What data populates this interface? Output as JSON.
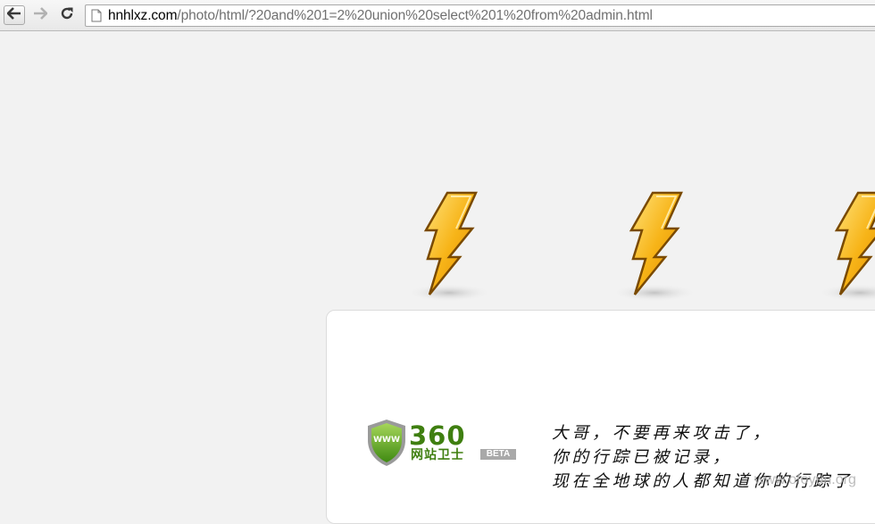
{
  "browser": {
    "url_host": "hnhlxz.com",
    "url_path": "/photo/html/?20and%201=2%20union%20select%201%20from%20admin.html",
    "back_icon": "back-arrow-icon",
    "forward_icon": "forward-arrow-icon",
    "reload_icon": "reload-icon",
    "page_icon": "page-icon"
  },
  "page": {
    "bolts": [
      "lightning-bolt-icon",
      "lightning-bolt-icon",
      "lightning-bolt-icon"
    ],
    "logo": {
      "number": "360",
      "name": "网站卫士",
      "badge": "BETA",
      "shield_text": "WWW"
    },
    "message_lines": [
      "大哥，不要再来攻击了，",
      "你的行踪已被记录，",
      "现在全地球的人都知道你的行踪了"
    ],
    "watermark": "www.ofoyun.org",
    "colors": {
      "page_bg": "#f2f2f2",
      "logo_green": "#3f7f10",
      "bolt_orange": "#f5a000"
    }
  }
}
